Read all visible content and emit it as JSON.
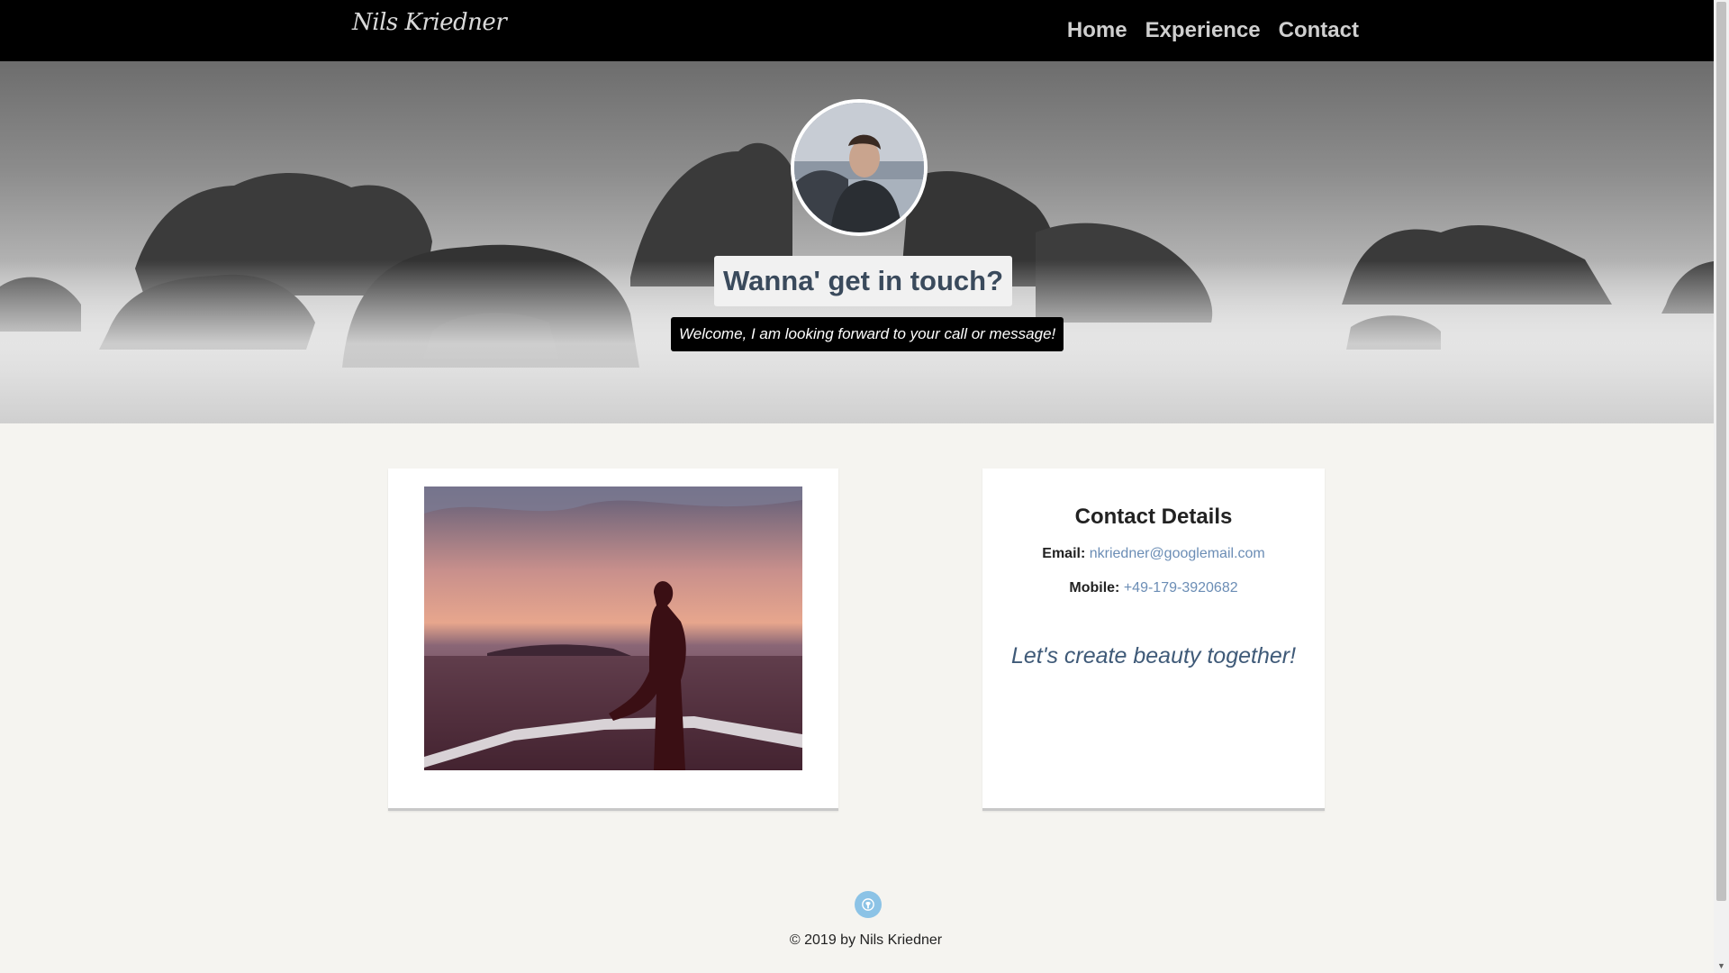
{
  "brand": "Nils Kriedner",
  "nav": {
    "items": [
      "Home",
      "Experience",
      "Contact"
    ]
  },
  "hero": {
    "title": "Wanna' get in touch?",
    "subtitle": "Welcome, I am looking forward to your call or message!"
  },
  "contact": {
    "title": "Contact Details",
    "email_label": "Email:",
    "email": "nkriedner@googlemail.com",
    "mobile_label": "Mobile:",
    "mobile": "+49-179-3920682",
    "tagline": "Let's create beauty together!"
  },
  "footer": {
    "icon": "github-icon",
    "copyright": "© 2019 by Nils Kriedner"
  },
  "colors": {
    "navbar": "#000000",
    "link": "#6b8db5",
    "tagline": "#3f5a78",
    "footer_icon": "#8cc3e6"
  }
}
